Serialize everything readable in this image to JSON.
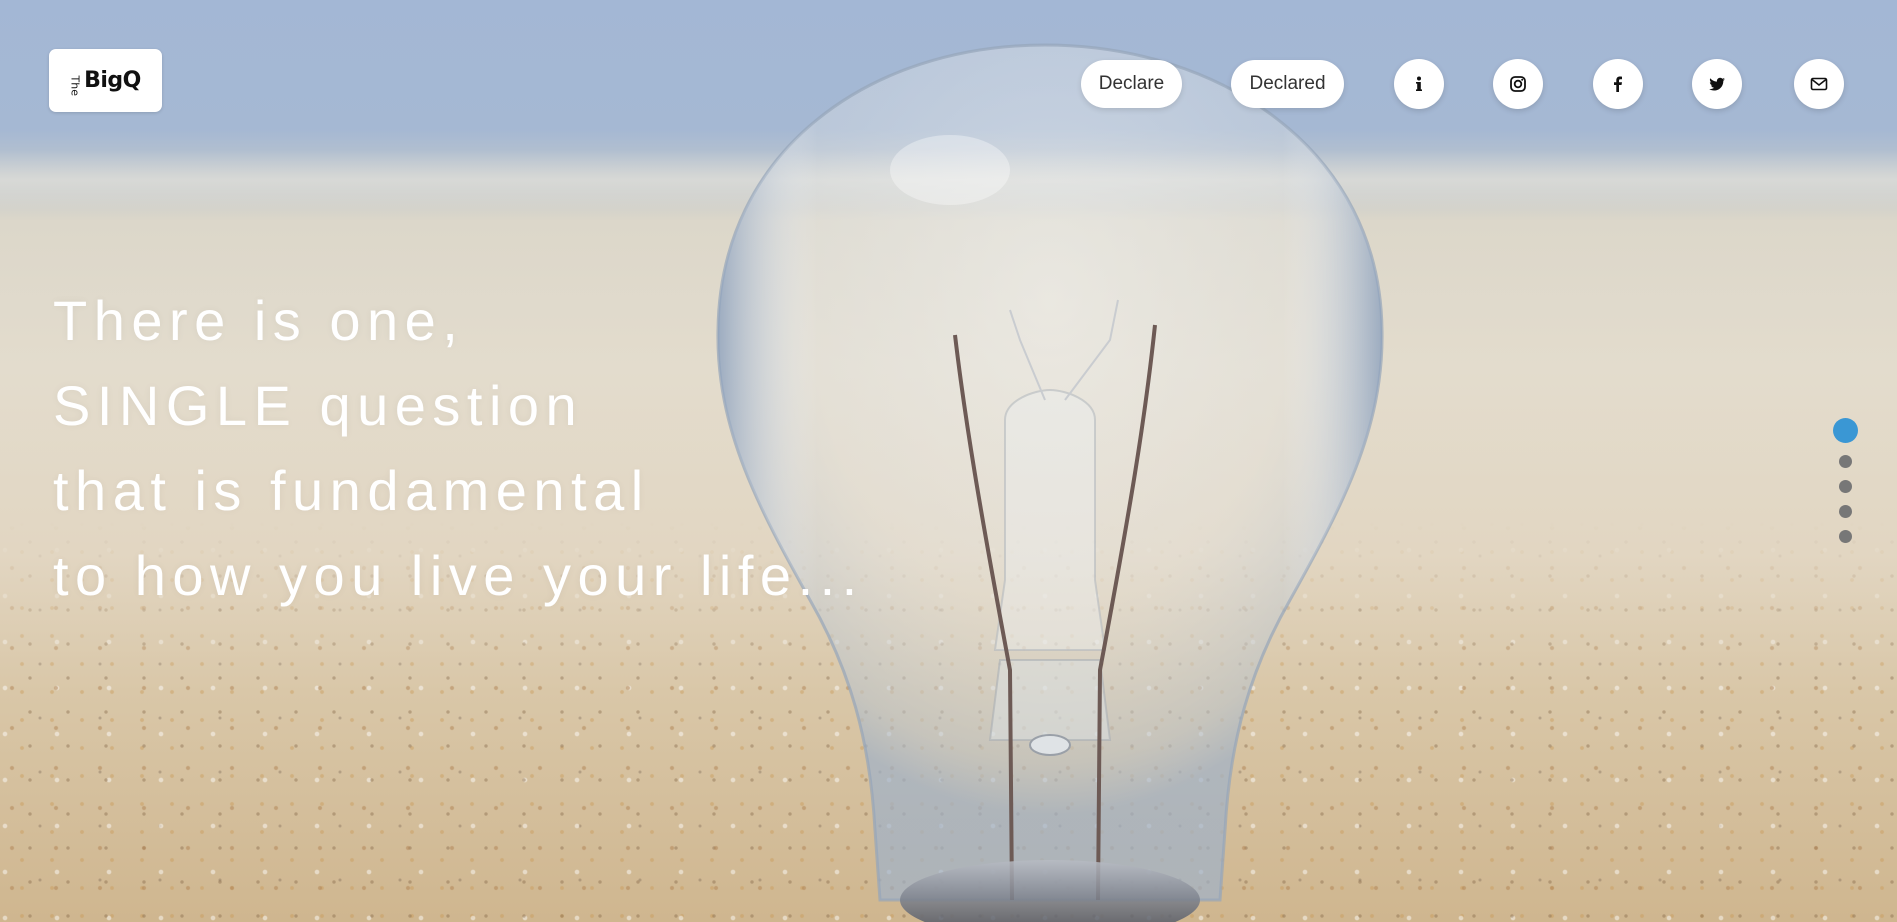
{
  "brand": {
    "logo_prefix": "The",
    "logo_text": "BigQ"
  },
  "nav": {
    "declare_label": "Declare",
    "declared_label": "Declared",
    "icons": [
      "info-icon",
      "instagram-icon",
      "facebook-icon",
      "twitter-icon",
      "mail-icon"
    ]
  },
  "hero": {
    "lines": [
      "There is one,",
      "SINGLE question",
      "that is fundamental",
      "to how you live your life..."
    ]
  },
  "pagination": {
    "total": 5,
    "active_index": 0,
    "active_color": "#3a97d4",
    "inactive_color": "#777777"
  },
  "colors": {
    "sky": "#a3b7d5",
    "sand": "#e2d6c2",
    "button_bg": "#ffffff"
  }
}
